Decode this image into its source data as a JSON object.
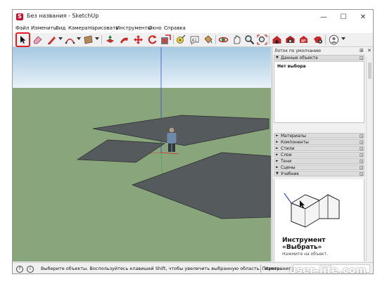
{
  "window": {
    "title": "Без названия - SketchUp",
    "minimize_glyph": "—",
    "maximize_glyph": "☐",
    "close_glyph": "✕"
  },
  "menu": {
    "items": [
      "Файл",
      "Изменить",
      "Вид",
      "Камера",
      "Нарисовать",
      "Инструменты",
      "Окно",
      "Справка"
    ]
  },
  "toolbar": {
    "tools": [
      "select-icon",
      "eraser-icon",
      "pencil-line-icon",
      "arc-icon",
      "rectangle-icon",
      "push-pull-icon",
      "follow-me-icon",
      "move-icon",
      "rotate-icon",
      "scale-icon",
      "tape-measure-icon",
      "text-icon",
      "paint-bucket-icon",
      "orbit-icon",
      "pan-icon",
      "zoom-icon",
      "zoom-extents-icon",
      "warehouse-icon",
      "extension-warehouse-icon",
      "send-to-layout-icon",
      "extension-manager-icon",
      "account-icon"
    ],
    "highlight_color": "#e02020"
  },
  "panel": {
    "title": "Лоток по умолчанию",
    "pin_glyph": "⊞",
    "close_glyph": "✕",
    "entity_info": {
      "label": "Данные объекта",
      "value": "Нет выбора"
    },
    "sections": [
      "Материалы",
      "Компоненты",
      "Стили",
      "Слои",
      "Тени",
      "Сцены"
    ],
    "instructor": {
      "label": "Учебник",
      "title_line1": "Инструмент",
      "title_line2": "«Выбрать»",
      "subtitle": "Нажмите на объект."
    }
  },
  "status": {
    "message": "Выберите объекты. Воспользуйтесь клавишей Shift, чтобы увеличить выбранную область. Перета...",
    "measurements_label": "Измерения",
    "icons": [
      "help-icon",
      "info-icon"
    ]
  },
  "watermark": "user-life.com",
  "colors": {
    "sky_top": "#a6c9e2",
    "sky_bottom": "#e8f1f8",
    "ground": "#88a57c",
    "surface": "#555a5c",
    "blue_axis": "#2f4bd8",
    "red_axis": "#d03030",
    "green_axis": "#2e9a2e"
  }
}
